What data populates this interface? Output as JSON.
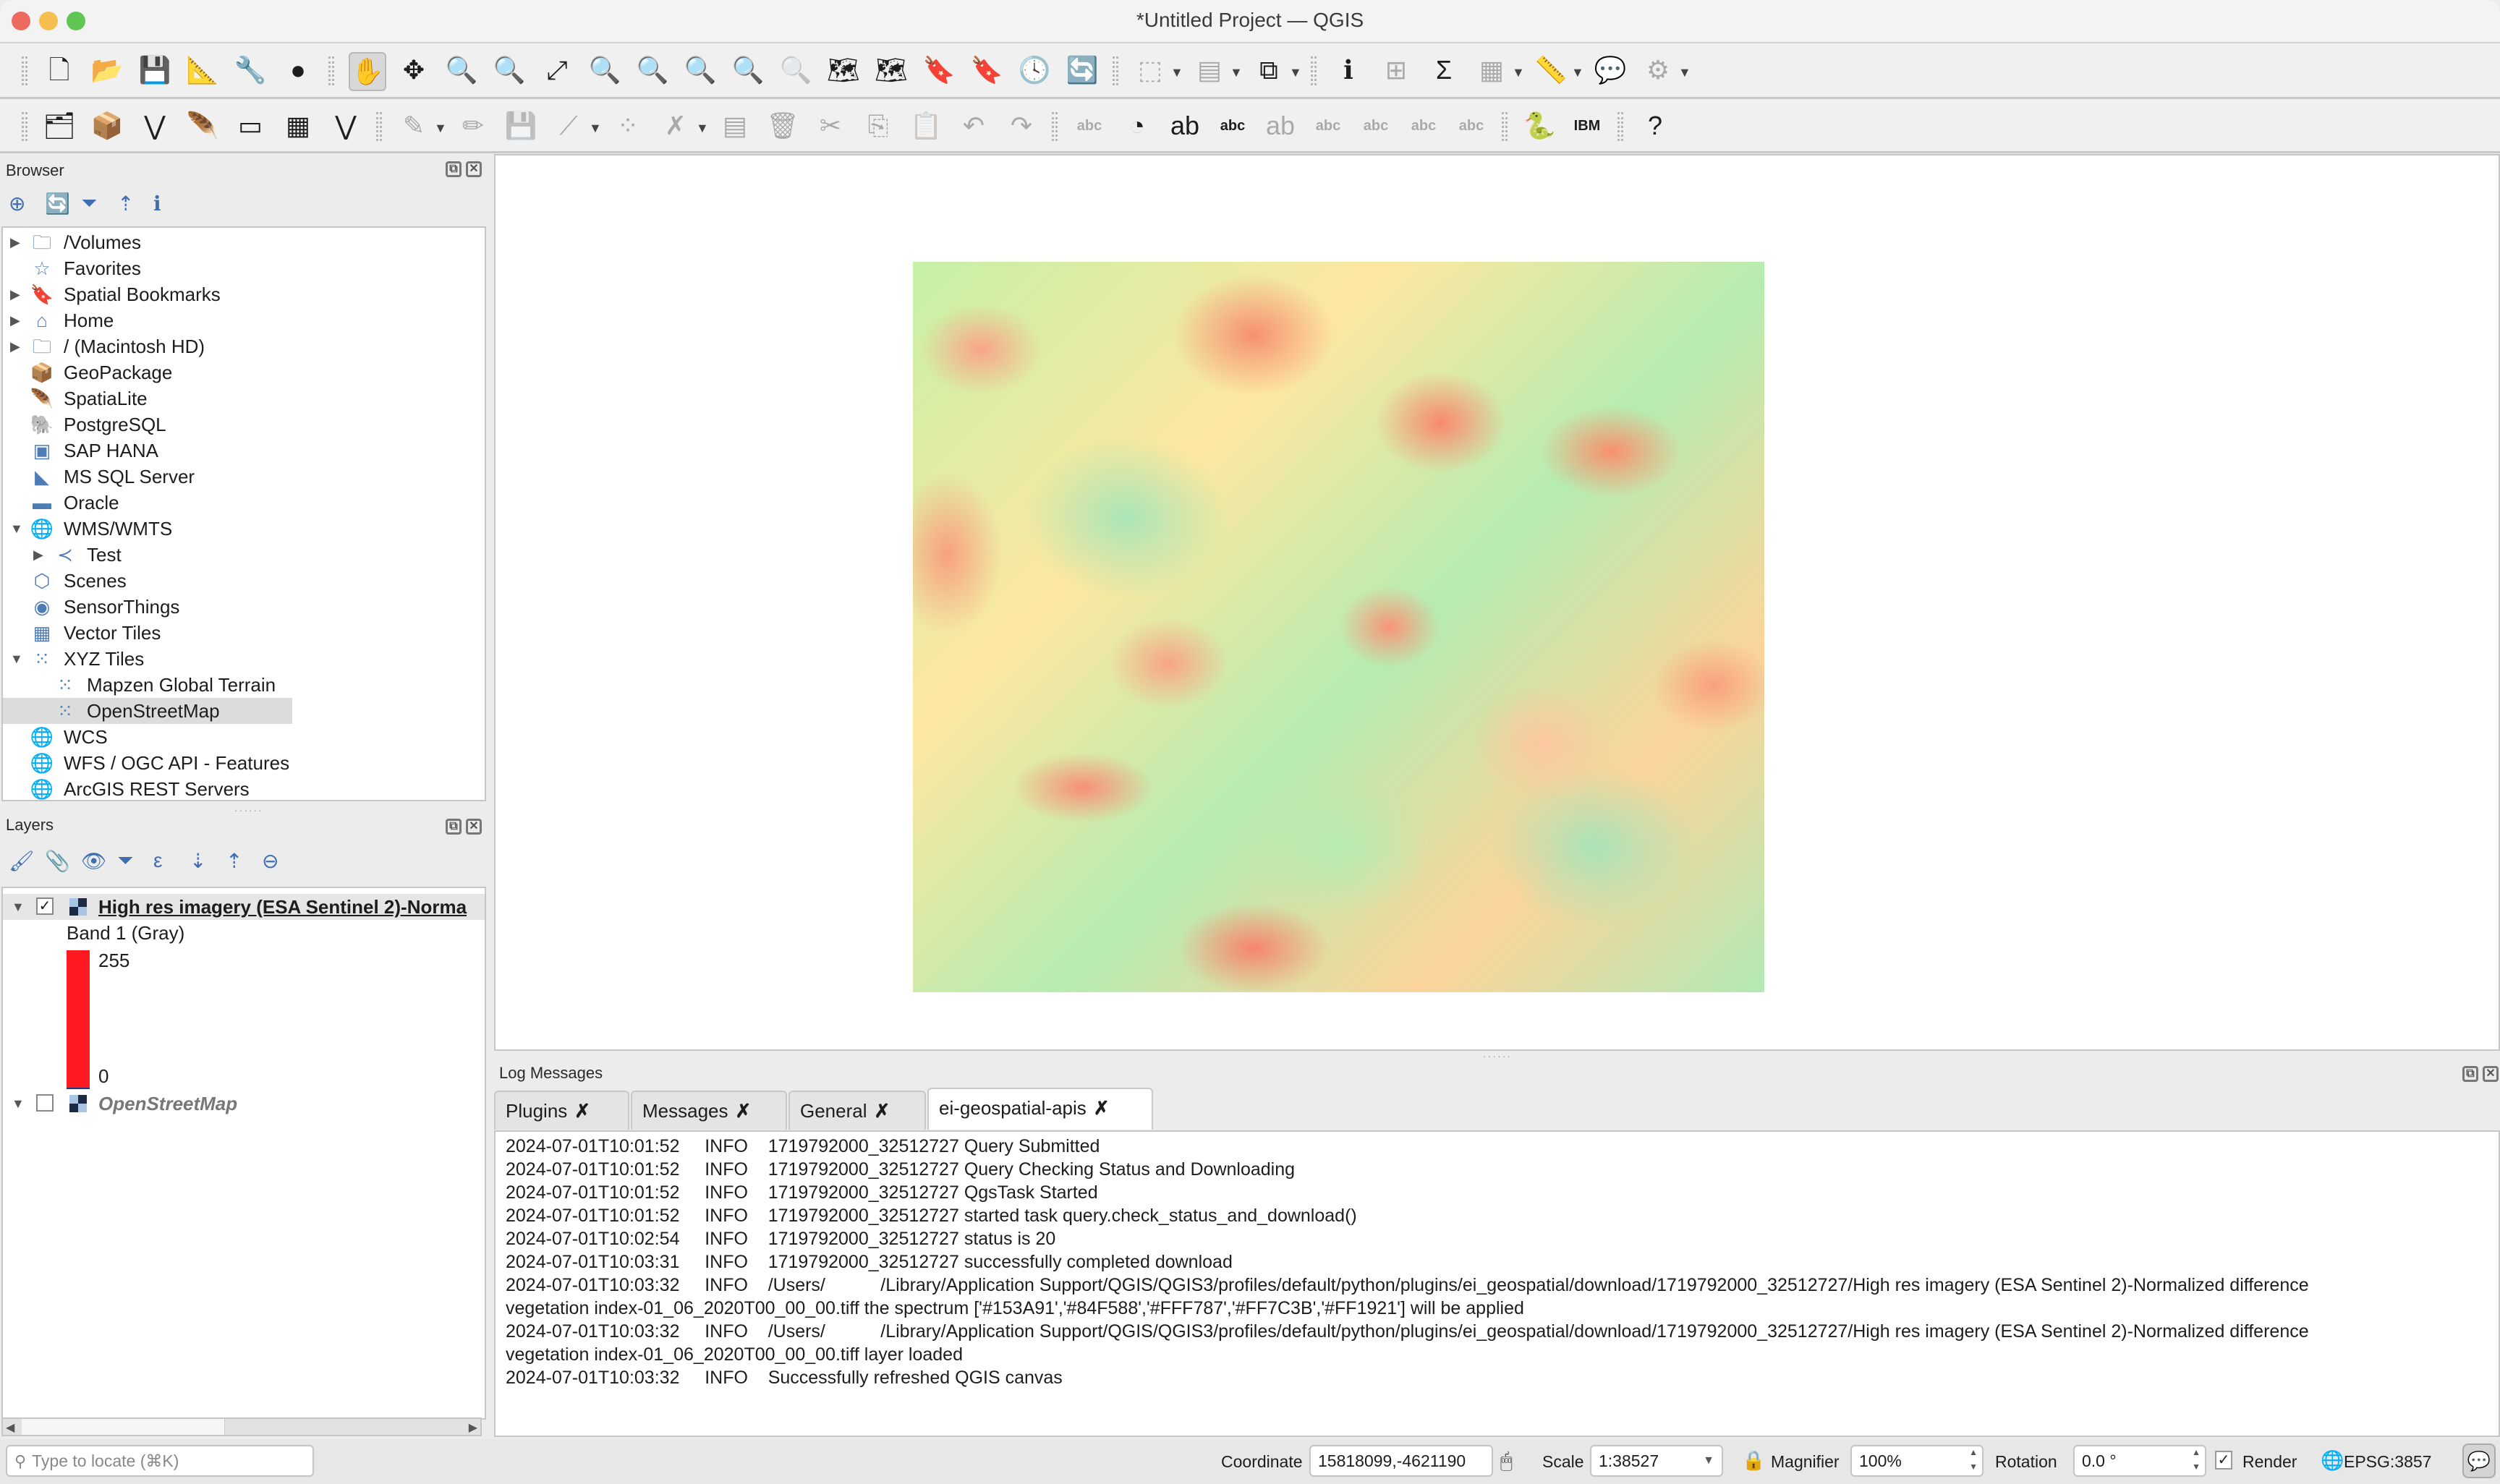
{
  "window": {
    "title": "*Untitled Project — QGIS",
    "traffic_lights": {
      "close": "#ed6a5e",
      "minimize": "#f5bf4f",
      "zoom": "#61c554"
    }
  },
  "toolbar_row1": [
    {
      "name": "new-project-icon",
      "glyph": "🗋"
    },
    {
      "name": "open-project-icon",
      "glyph": "📂"
    },
    {
      "name": "save-project-icon",
      "glyph": "💾"
    },
    {
      "name": "new-print-layout-icon",
      "glyph": "📐"
    },
    {
      "name": "project-properties-icon",
      "glyph": "🔧"
    },
    {
      "name": "style-manager-icon",
      "glyph": "●"
    },
    {
      "name": "pan-map-icon",
      "glyph": "✋"
    },
    {
      "name": "pan-to-selection-icon",
      "glyph": "✥"
    },
    {
      "name": "zoom-in-icon",
      "glyph": "🔍"
    },
    {
      "name": "zoom-out-icon",
      "glyph": "🔍"
    },
    {
      "name": "zoom-full-icon",
      "glyph": "⤢"
    },
    {
      "name": "zoom-to-selection-icon",
      "glyph": "🔍"
    },
    {
      "name": "zoom-to-layer-icon",
      "glyph": "🔍"
    },
    {
      "name": "zoom-native-resolution-icon",
      "glyph": "🔍"
    },
    {
      "name": "zoom-last-icon",
      "glyph": "🔍"
    },
    {
      "name": "zoom-next-icon",
      "glyph": "🔍"
    },
    {
      "name": "new-map-view-icon",
      "glyph": "🗺"
    },
    {
      "name": "new-3d-map-view-icon",
      "glyph": "🗺"
    },
    {
      "name": "new-spatial-bookmark-icon",
      "glyph": "🔖"
    },
    {
      "name": "show-spatial-bookmarks-icon",
      "glyph": "🔖"
    },
    {
      "name": "temporal-controller-icon",
      "glyph": "🕓"
    },
    {
      "name": "refresh-icon",
      "glyph": "🔄"
    },
    {
      "name": "select-features-icon",
      "glyph": "⬚"
    },
    {
      "name": "open-attribute-table-icon",
      "glyph": "▤"
    },
    {
      "name": "deselect-all-icon",
      "glyph": "⧉"
    },
    {
      "name": "identify-features-icon",
      "glyph": "ℹ"
    },
    {
      "name": "field-calculator-icon",
      "glyph": "⊞"
    },
    {
      "name": "statistical-summary-icon",
      "glyph": "Σ"
    },
    {
      "name": "attribute-table-icon",
      "glyph": "▦"
    },
    {
      "name": "measure-line-icon",
      "glyph": "📏"
    },
    {
      "name": "map-tips-icon",
      "glyph": "💬"
    },
    {
      "name": "actions-icon",
      "glyph": "⚙"
    }
  ],
  "toolbar_row2": [
    {
      "name": "data-source-manager-icon",
      "glyph": "🗂"
    },
    {
      "name": "new-geopackage-layer-icon",
      "glyph": "📦"
    },
    {
      "name": "new-shapefile-layer-icon",
      "glyph": "⋁"
    },
    {
      "name": "new-spatialite-layer-icon",
      "glyph": "🪶"
    },
    {
      "name": "new-temporary-layer-icon",
      "glyph": "▭"
    },
    {
      "name": "new-virtual-layer-icon",
      "glyph": "▦"
    },
    {
      "name": "new-mesh-layer-icon",
      "glyph": "⋁"
    },
    {
      "name": "current-edits-icon",
      "glyph": "✎"
    },
    {
      "name": "toggle-editing-icon",
      "glyph": "✏"
    },
    {
      "name": "save-edits-icon",
      "glyph": "💾"
    },
    {
      "name": "digitize-line-icon",
      "glyph": "⟋"
    },
    {
      "name": "vertex-tool-icon",
      "glyph": "⁘"
    },
    {
      "name": "modify-attributes-icon",
      "glyph": "✗"
    },
    {
      "name": "edit-table-icon",
      "glyph": "▤"
    },
    {
      "name": "delete-selected-icon",
      "glyph": "🗑"
    },
    {
      "name": "cut-features-icon",
      "glyph": "✂"
    },
    {
      "name": "copy-features-icon",
      "glyph": "⎘"
    },
    {
      "name": "paste-features-icon",
      "glyph": "📋"
    },
    {
      "name": "undo-icon",
      "glyph": "↶"
    },
    {
      "name": "redo-icon",
      "glyph": "↷"
    },
    {
      "name": "label-toolbar-icon",
      "glyph": "abc"
    },
    {
      "name": "diagram-options-icon",
      "glyph": "◔"
    },
    {
      "name": "highlight-pin-labels-icon",
      "glyph": "ab"
    },
    {
      "name": "toggle-display-unplaced-labels-icon",
      "glyph": "abc"
    },
    {
      "name": "pin-unpin-labels-icon",
      "glyph": "ab"
    },
    {
      "name": "show-hide-labels-icon",
      "glyph": "abc"
    },
    {
      "name": "move-label-icon",
      "glyph": "abc"
    },
    {
      "name": "rotate-label-icon",
      "glyph": "abc"
    },
    {
      "name": "change-label-icon",
      "glyph": "abc"
    },
    {
      "name": "python-console-icon",
      "glyph": "🐍"
    },
    {
      "name": "ibm-plugin-icon",
      "glyph": "IBM"
    },
    {
      "name": "help-icon",
      "glyph": "?"
    }
  ],
  "browser": {
    "title": "Browser",
    "toolbar": [
      "add-selected-layers-icon",
      "refresh-icon",
      "filter-browser-icon",
      "collapse-all-icon",
      "properties-info-icon"
    ],
    "items": [
      {
        "label": "/Volumes",
        "icon": "folder-icon",
        "glyph": "🗀",
        "expander": "▶",
        "indent": 0
      },
      {
        "label": "Favorites",
        "icon": "star-icon",
        "glyph": "☆",
        "expander": "",
        "indent": 0
      },
      {
        "label": "Spatial Bookmarks",
        "icon": "bookmark-icon",
        "glyph": "🔖",
        "expander": "▶",
        "indent": 0
      },
      {
        "label": "Home",
        "icon": "home-folder-icon",
        "glyph": "⌂",
        "expander": "▶",
        "indent": 0
      },
      {
        "label": "/ (Macintosh HD)",
        "icon": "folder-icon",
        "glyph": "🗀",
        "expander": "▶",
        "indent": 0
      },
      {
        "label": "GeoPackage",
        "icon": "geopackage-icon",
        "glyph": "📦",
        "expander": "",
        "indent": 0
      },
      {
        "label": "SpatiaLite",
        "icon": "spatialite-feather-icon",
        "glyph": "🪶",
        "expander": "",
        "indent": 0
      },
      {
        "label": "PostgreSQL",
        "icon": "postgresql-elephant-icon",
        "glyph": "🐘",
        "expander": "",
        "indent": 0
      },
      {
        "label": "SAP HANA",
        "icon": "sap-hana-icon",
        "glyph": "▣",
        "expander": "",
        "indent": 0
      },
      {
        "label": "MS SQL Server",
        "icon": "mssql-icon",
        "glyph": "◣",
        "expander": "",
        "indent": 0
      },
      {
        "label": "Oracle",
        "icon": "oracle-icon",
        "glyph": "▬",
        "expander": "",
        "indent": 0
      },
      {
        "label": "WMS/WMTS",
        "icon": "wms-globe-icon",
        "glyph": "🌐",
        "expander": "▼",
        "indent": 0
      },
      {
        "label": "Test",
        "icon": "connection-icon",
        "glyph": "≺",
        "expander": "▶",
        "indent": 1
      },
      {
        "label": "Scenes",
        "icon": "scenes-cube-icon",
        "glyph": "⬡",
        "expander": "",
        "indent": 0
      },
      {
        "label": "SensorThings",
        "icon": "sensorthings-icon",
        "glyph": "◉",
        "expander": "",
        "indent": 0
      },
      {
        "label": "Vector Tiles",
        "icon": "vector-tiles-icon",
        "glyph": "▦",
        "expander": "",
        "indent": 0
      },
      {
        "label": "XYZ Tiles",
        "icon": "xyz-tiles-icon",
        "glyph": "⁙",
        "expander": "▼",
        "indent": 0
      },
      {
        "label": "Mapzen Global Terrain",
        "icon": "xyz-tile-icon",
        "glyph": "⁙",
        "expander": "",
        "indent": 1
      },
      {
        "label": "OpenStreetMap",
        "icon": "xyz-tile-icon",
        "glyph": "⁙",
        "expander": "",
        "indent": 1,
        "selected": true
      },
      {
        "label": "WCS",
        "icon": "wcs-globe-icon",
        "glyph": "🌐",
        "expander": "",
        "indent": 0
      },
      {
        "label": "WFS / OGC API - Features",
        "icon": "wfs-icon",
        "glyph": "🌐",
        "expander": "",
        "indent": 0
      },
      {
        "label": "ArcGIS REST Servers",
        "icon": "arcgis-rest-icon",
        "glyph": "🌐",
        "expander": "",
        "indent": 0
      }
    ]
  },
  "layers": {
    "title": "Layers",
    "toolbar": [
      "open-layer-styling-icon",
      "add-group-icon",
      "manage-map-themes-icon",
      "filter-legend-icon",
      "filter-by-expression-icon",
      "expand-all-icon",
      "collapse-all-icon",
      "remove-layer-icon"
    ],
    "items": [
      {
        "label": "High res  imagery (ESA Sentinel 2)-Norma",
        "checked": true,
        "bold": true,
        "expanded": true,
        "legend": {
          "band": "Band 1 (Gray)",
          "max": "255",
          "min": "0",
          "color": "#ff1921"
        }
      },
      {
        "label": "OpenStreetMap",
        "checked": false,
        "italic": true,
        "expanded": true
      }
    ]
  },
  "map": {
    "raster_spectrum": [
      "#153A91",
      "#84F588",
      "#FFF787",
      "#FF7C3B",
      "#FF1921"
    ]
  },
  "log_panel": {
    "title": "Log Messages",
    "tabs": [
      {
        "label": "Plugins",
        "active": false
      },
      {
        "label": "Messages",
        "active": false
      },
      {
        "label": "General",
        "active": false
      },
      {
        "label": "ei-geospatial-apis",
        "active": true
      }
    ],
    "close_glyph": "✗",
    "lines": [
      "2024-07-01T10:01:52     INFO    1719792000_32512727 Query Submitted",
      "2024-07-01T10:01:52     INFO    1719792000_32512727 Query Checking Status and Downloading",
      "2024-07-01T10:01:52     INFO    1719792000_32512727 QgsTask Started",
      "2024-07-01T10:01:52     INFO    1719792000_32512727 started task query.check_status_and_download()",
      "2024-07-01T10:02:54     INFO    1719792000_32512727 status is 20",
      "2024-07-01T10:03:31     INFO    1719792000_32512727 successfully completed download",
      "2024-07-01T10:03:32     INFO    /Users/           /Library/Application Support/QGIS/QGIS3/profiles/default/python/plugins/ei_geospatial/download/1719792000_32512727/High res imagery (ESA Sentinel 2)-Normalized difference",
      "vegetation index-01_06_2020T00_00_00.tiff the spectrum ['#153A91','#84F588','#FFF787','#FF7C3B','#FF1921'] will be applied",
      "2024-07-01T10:03:32     INFO    /Users/           /Library/Application Support/QGIS/QGIS3/profiles/default/python/plugins/ei_geospatial/download/1719792000_32512727/High res imagery (ESA Sentinel 2)-Normalized difference",
      "vegetation index-01_06_2020T00_00_00.tiff layer loaded",
      "2024-07-01T10:03:32     INFO    Successfully refreshed QGIS canvas"
    ]
  },
  "statusbar": {
    "locator_placeholder": "Type to locate (⌘K)",
    "coordinate_label": "Coordinate",
    "coordinate_value": "15818099,-4621190",
    "scale_label": "Scale",
    "scale_value": "1:38527",
    "magnifier_label": "Magnifier",
    "magnifier_value": "100%",
    "rotation_label": "Rotation",
    "rotation_value": "0.0 °",
    "render_label": "Render",
    "render_checked": true,
    "crs": "EPSG:3857"
  }
}
